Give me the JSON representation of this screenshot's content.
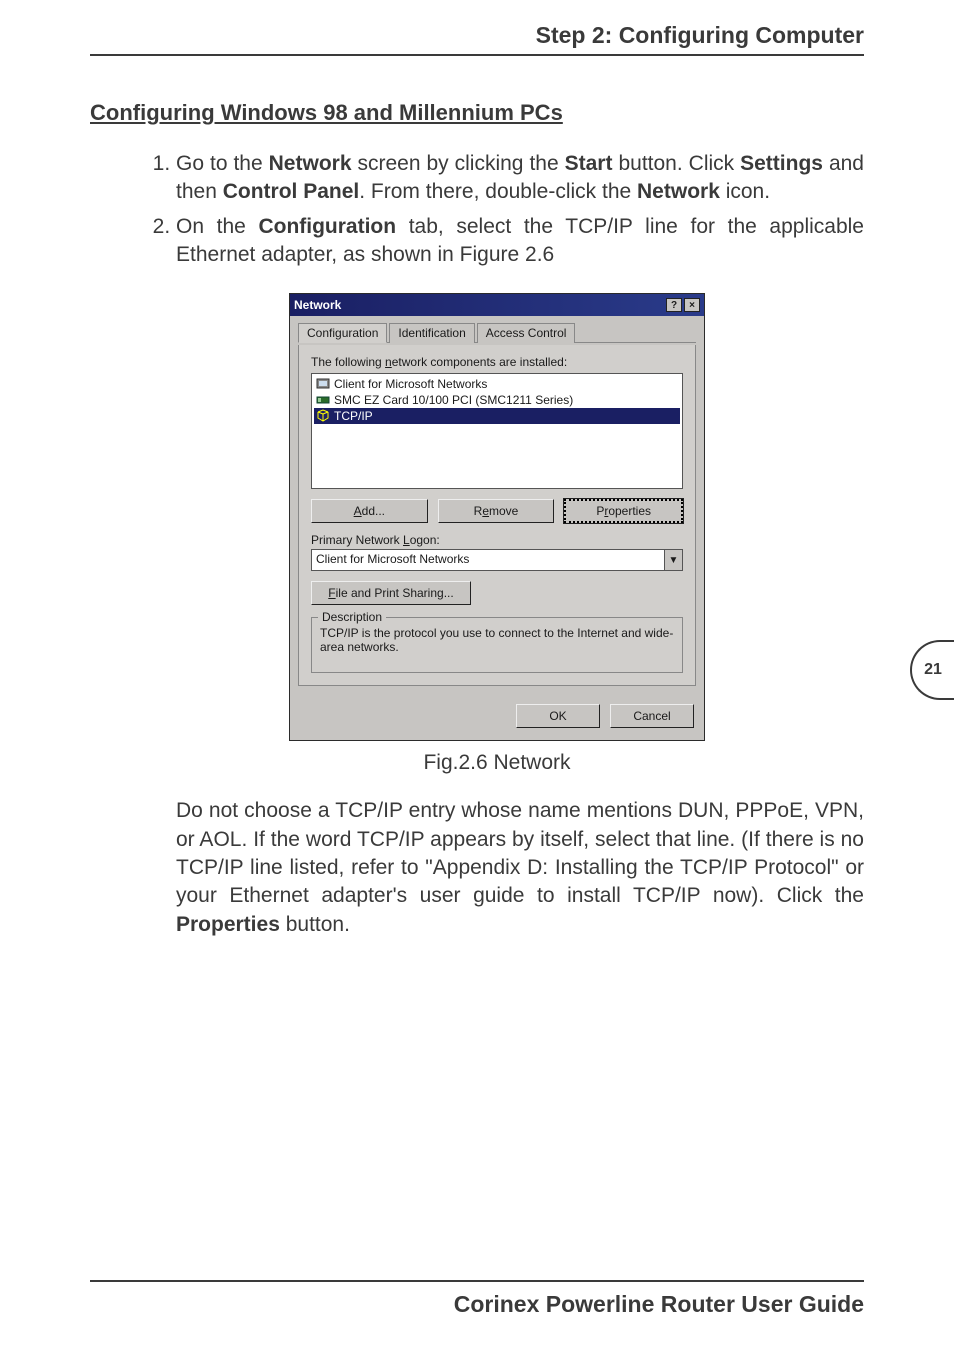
{
  "header": {
    "title": "Step 2: Configuring Computer"
  },
  "section_title": "Configuring Windows 98 and Millennium PCs",
  "steps": {
    "1": {
      "pre1": "Go to the ",
      "b1": "Network",
      "mid1": " screen by clicking the ",
      "b2": "Start",
      "mid2": " button. Click ",
      "b3": "Settings",
      "mid3": " and then ",
      "b4": "Control Panel",
      "mid4": ". From there, double-click the ",
      "b5": "Network",
      "post": " icon."
    },
    "2": {
      "pre1": "On the ",
      "b1": "Configuration",
      "post": " tab, select the TCP/IP line for the applicable Ethernet adapter, as shown in Figure 2.6"
    }
  },
  "dialog": {
    "title": "Network",
    "help": "?",
    "close": "×",
    "tabs": [
      "Configuration",
      "Identification",
      "Access Control"
    ],
    "installed_label_pre": "The following ",
    "installed_label_u": "n",
    "installed_label_post": "etwork components are installed:",
    "list_items": [
      {
        "label": "Client for Microsoft Networks"
      },
      {
        "label": "SMC EZ Card 10/100 PCI (SMC1211 Series)"
      },
      {
        "label": "TCP/IP"
      }
    ],
    "buttons": {
      "add_u": "A",
      "add_r": "dd...",
      "remove_pre": "R",
      "remove_u": "e",
      "remove_post": "move",
      "props_pre": "P",
      "props_u": "r",
      "props_post": "operties"
    },
    "primary_label_pre": "Primary Network ",
    "primary_label_u": "L",
    "primary_label_post": "ogon:",
    "primary_value": "Client for Microsoft Networks",
    "fps_u": "F",
    "fps_r": "ile and Print Sharing...",
    "group_title": "Description",
    "group_text": "TCP/IP is the protocol you use to connect to the Internet and wide-area networks.",
    "ok": "OK",
    "cancel": "Cancel"
  },
  "figure_caption": "Fig.2.6 Network",
  "para_after": {
    "pre": "Do not choose a TCP/IP entry whose name mentions DUN, PPPoE, VPN, or AOL. If the word TCP/IP appears by itself, select that line. (If there is no TCP/IP line listed, refer to \"Appendix D: Installing the TCP/IP Protocol\" or your Ethernet adapter's user guide to install TCP/IP now). Click the ",
    "b": "Properties",
    "post": " button."
  },
  "page_number": "21",
  "footer": "Corinex Powerline Router User Guide"
}
